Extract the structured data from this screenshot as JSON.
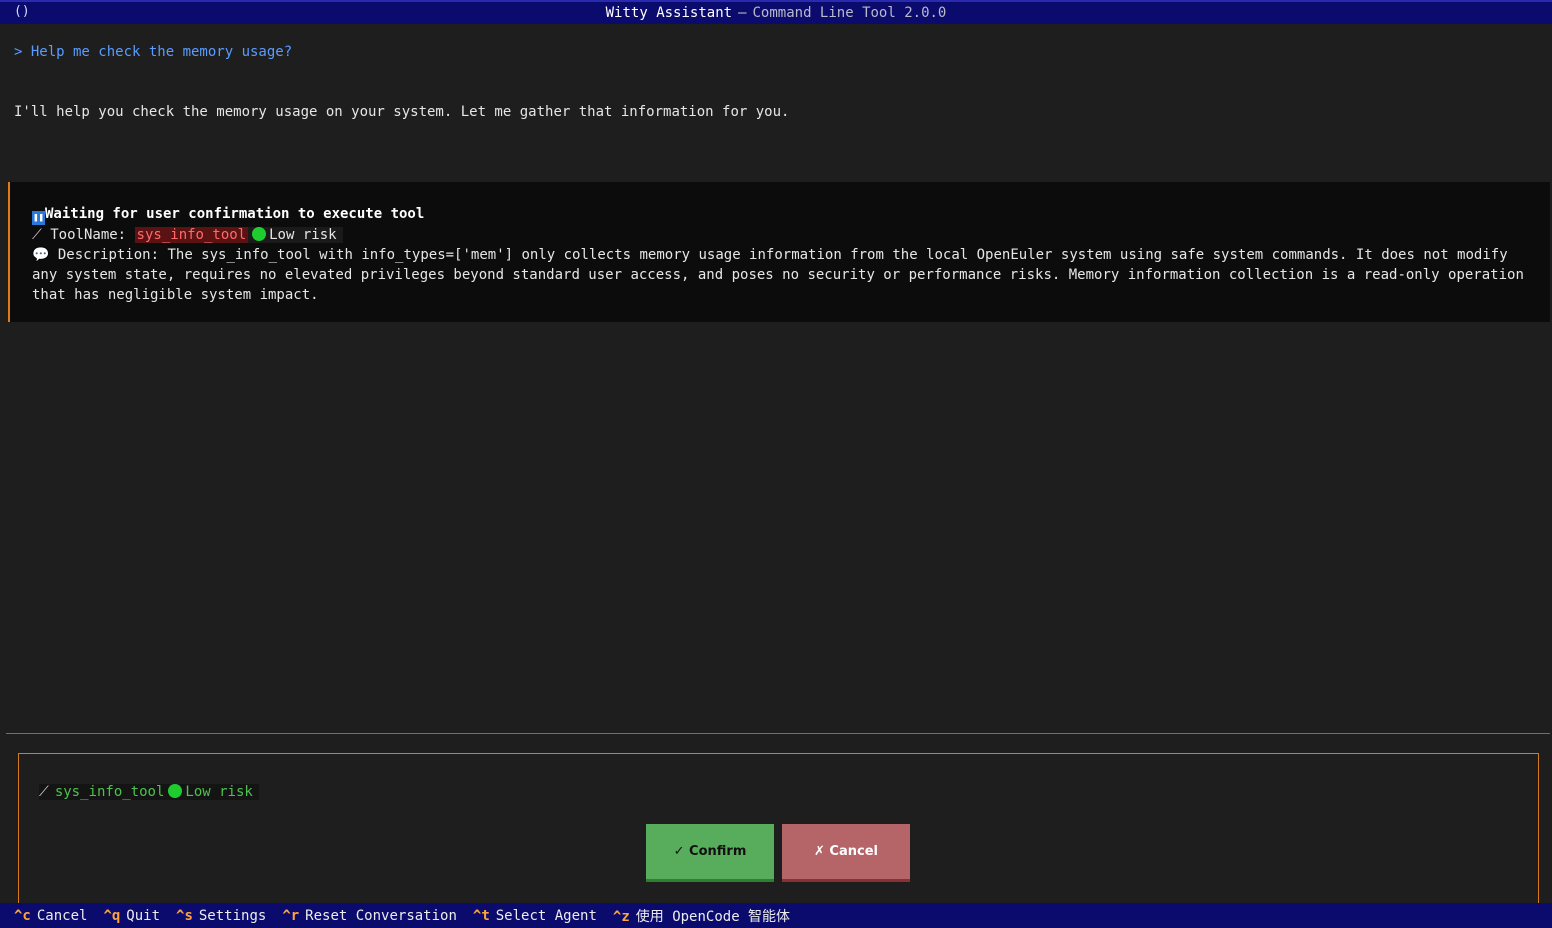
{
  "window": {
    "title": "Witty Assistant",
    "separator": "—",
    "subtitle": "Command Line Tool 2.0.0",
    "left_icon": "()"
  },
  "chat": {
    "user_message": "> Help me check the memory usage?",
    "assistant_message": "I'll help you check the memory usage on your system. Let me gather that information for you."
  },
  "confirmation": {
    "pause_icon": "pause-icon",
    "waiting_text": "Waiting for user confirmation to execute tool",
    "toolname_label": "ToolName:",
    "tool_name": "sys_info_tool",
    "risk_label": "Low risk",
    "risk_color": "#1fcc2f",
    "description_label": "Description:",
    "description_text": "The sys_info_tool with info_types=['mem'] only collects memory usage information from the local OpenEuler system using safe system commands. It does not modify any system state, requires no elevated privileges beyond standard user access, and poses no security or performance risks. Memory information collection is a read-only operation that has negligible system impact."
  },
  "dialog": {
    "tool_name": "sys_info_tool",
    "risk_label": "Low risk",
    "confirm_label": "✓ Confirm",
    "cancel_label": "✗ Cancel"
  },
  "footer": {
    "hints": [
      {
        "key": "^c",
        "label": "Cancel"
      },
      {
        "key": "^q",
        "label": "Quit"
      },
      {
        "key": "^s",
        "label": "Settings"
      },
      {
        "key": "^r",
        "label": "Reset Conversation"
      },
      {
        "key": "^t",
        "label": "Select Agent"
      },
      {
        "key": "^z",
        "label": "使用 OpenCode 智能体"
      }
    ]
  },
  "colors": {
    "title_bar_bg": "#0b0b6e",
    "accent_orange": "#e07b1a",
    "user_text": "#5a9cff",
    "confirm_green": "#57ad5b",
    "cancel_red": "#b56468",
    "tool_name_red": "#ff6b6b"
  }
}
